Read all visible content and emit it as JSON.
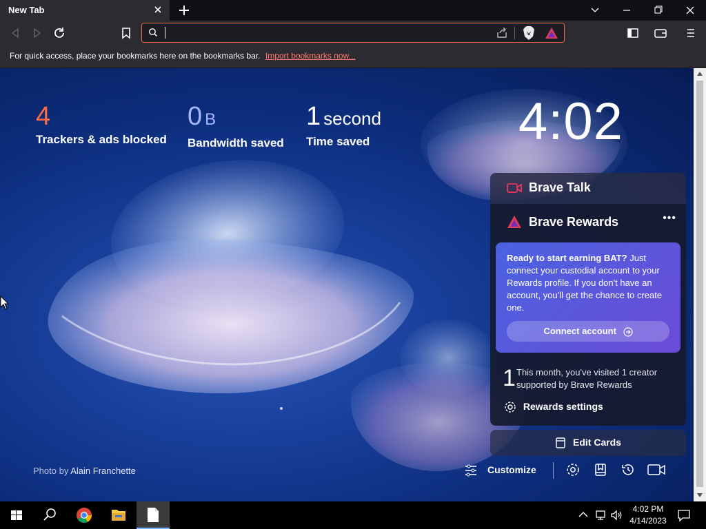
{
  "browser": {
    "tab_title": "New Tab",
    "bookmarks_bar_message": "For quick access, place your bookmarks here on the bookmarks bar.",
    "import_link": "Import bookmarks now..."
  },
  "stats": {
    "trackers_value": "4",
    "trackers_label": "Trackers & ads blocked",
    "bandwidth_value": "0",
    "bandwidth_unit": "B",
    "bandwidth_label": "Bandwidth saved",
    "time_value": "1",
    "time_unit": "second",
    "time_label": "Time saved"
  },
  "clock": "4:02",
  "cards": {
    "talk_title": "Brave Talk",
    "rewards_title": "Brave Rewards",
    "rewards_menu": "•••",
    "promo_bold": "Ready to start earning BAT?",
    "promo_text": "Just connect your custodial account to your Rewards profile. If you don't have an account, you'll get the chance to create one.",
    "connect_label": "Connect account",
    "visit_count": "1",
    "visit_text": "This month, you've visited 1 creator supported by Brave Rewards",
    "settings_label": "Rewards settings",
    "edit_cards_label": "Edit Cards"
  },
  "photo_credit": {
    "prefix": "Photo by",
    "author": "Alain Franchette"
  },
  "bottom": {
    "customize_label": "Customize"
  },
  "taskbar": {
    "time": "4:02 PM",
    "date": "4/14/2023"
  },
  "colors": {
    "accent_orange": "#f06b4a",
    "trackers_num": "#ff6b4a",
    "bandwidth_num": "#a8b8ff",
    "promo_gradient_start": "#4a63e0",
    "promo_gradient_end": "#6b4bd8"
  }
}
